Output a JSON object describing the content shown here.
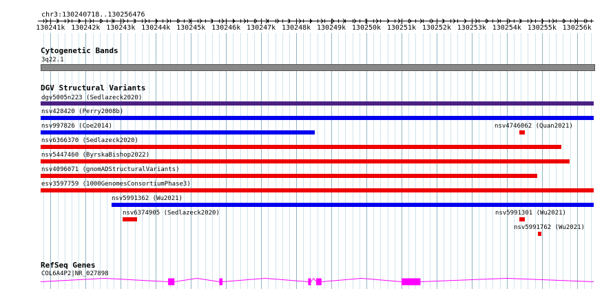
{
  "location": "chr3:130240718..130256476",
  "ruler": {
    "ticks": [
      "130241k",
      "130242k",
      "130243k",
      "130244k",
      "130245k",
      "130246k",
      "130247k",
      "130248k",
      "130249k",
      "130250k",
      "130251k",
      "130252k",
      "130253k",
      "130254k",
      "130255k",
      "130256k"
    ]
  },
  "cyto": {
    "title": "Cytogenetic Bands",
    "band": "3q22.1",
    "color": "#888888"
  },
  "dgv": {
    "title": "DGV Structural Variants",
    "features": [
      {
        "label": "dgv5005n223 (Sedlazeck2020)",
        "color": "#4b2083",
        "start": 130240718,
        "end": 130256476
      },
      {
        "label": "nsv428420 (Perry2008b)",
        "color": "#0000ee",
        "start": 130240718,
        "end": 130256476
      },
      {
        "label": "nsv997826 (Coe2014)",
        "color": "#0000ee",
        "start": 130240718,
        "end": 130248530
      },
      {
        "label": "nsv4746062 (Quan2021)",
        "color": "#ee0000",
        "start": 130254350,
        "end": 130254520
      },
      {
        "label": "nsv6366370 (Sedlazeck2020)",
        "color": "#ee0000",
        "start": 130240718,
        "end": 130255560
      },
      {
        "label": "nsv5447460 (ByrskaBishop2022)",
        "color": "#ee0000",
        "start": 130240718,
        "end": 130255780
      },
      {
        "label": "nsv4096071 (gnomADStructuralVariants)",
        "color": "#ee0000",
        "start": 130240718,
        "end": 130254860
      },
      {
        "label": "esv3597759 (1000GenomesConsortiumPhase3)",
        "color": "#ee0000",
        "start": 130240718,
        "end": 130256476
      },
      {
        "label": "nsv5991362 (Wu2021)",
        "color": "#0000ee",
        "start": 130242730,
        "end": 130256476
      },
      {
        "label": "nsv6374905 (Sedlazeck2020)",
        "color": "#ee0000",
        "start": 130243050,
        "end": 130243460
      },
      {
        "label": "nsv5991301 (Wu2021)",
        "color": "#ee0000",
        "start": 130254350,
        "end": 130254510
      },
      {
        "label": "nsv5991762 (Wu2021)",
        "color": "#ee0000",
        "start": 130254890,
        "end": 130254990
      }
    ]
  },
  "refseq": {
    "title": "RefSeq Genes",
    "gene": "COL6A4P2|NR_027898",
    "color": "#ff00ff",
    "exons": [
      [
        130244350,
        130244530
      ],
      [
        130245810,
        130245900
      ],
      [
        130248340,
        130248420
      ],
      [
        130248570,
        130248720
      ],
      [
        130251000,
        130251540
      ]
    ]
  },
  "colors": {
    "grid_minor": "#cfe4ec",
    "grid_major": "#8fb4c4"
  }
}
